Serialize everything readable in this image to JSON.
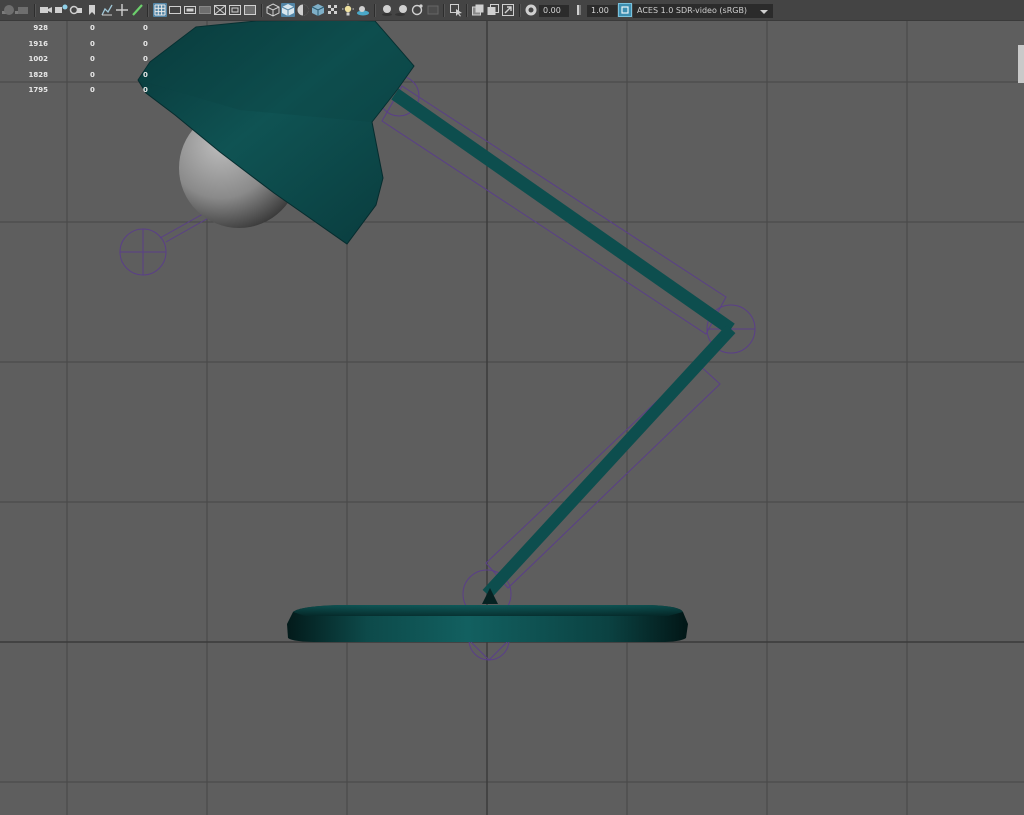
{
  "toolbar": {
    "exposure_value": "0.00",
    "gamma_value": "1.00",
    "color_space": "ACES 1.0 SDR-video (sRGB)",
    "icons": [
      "camera-icon",
      "camera-attributes-icon",
      "bookmark-icon",
      "image-plane-icon",
      "grid-toggle-icon",
      "film-gate-icon",
      "resolution-gate-icon",
      "safe-area-icon",
      "wireframe-icon",
      "smooth-shade-icon",
      "use-default-material-icon",
      "textured-icon",
      "lighting-icon",
      "shadows-icon",
      "ambient-occlusion-icon",
      "isolate-select-icon",
      "xray-icon",
      "xray-joints-icon",
      "camera-overlay-icon",
      "exposure-icon",
      "gamma-icon",
      "color-management-icon"
    ],
    "accent_color": "#5285a6"
  },
  "hud": {
    "col_a": [
      "928",
      "1916",
      "1002",
      "1828",
      "1795"
    ],
    "col_b": [
      "0",
      "0",
      "0",
      "0",
      "0"
    ],
    "col_c": [
      "0",
      "0",
      "0",
      "0",
      "0"
    ]
  },
  "scene": {
    "background": "#5e5e5e",
    "grid_color": "#3f3f3f",
    "mesh_color": "#0f4f4f",
    "joint_color": "#5c3f86",
    "objects": [
      "lamp-shade",
      "light-bulb",
      "upper-arm",
      "lower-arm",
      "lamp-base",
      "joint-locators"
    ]
  }
}
